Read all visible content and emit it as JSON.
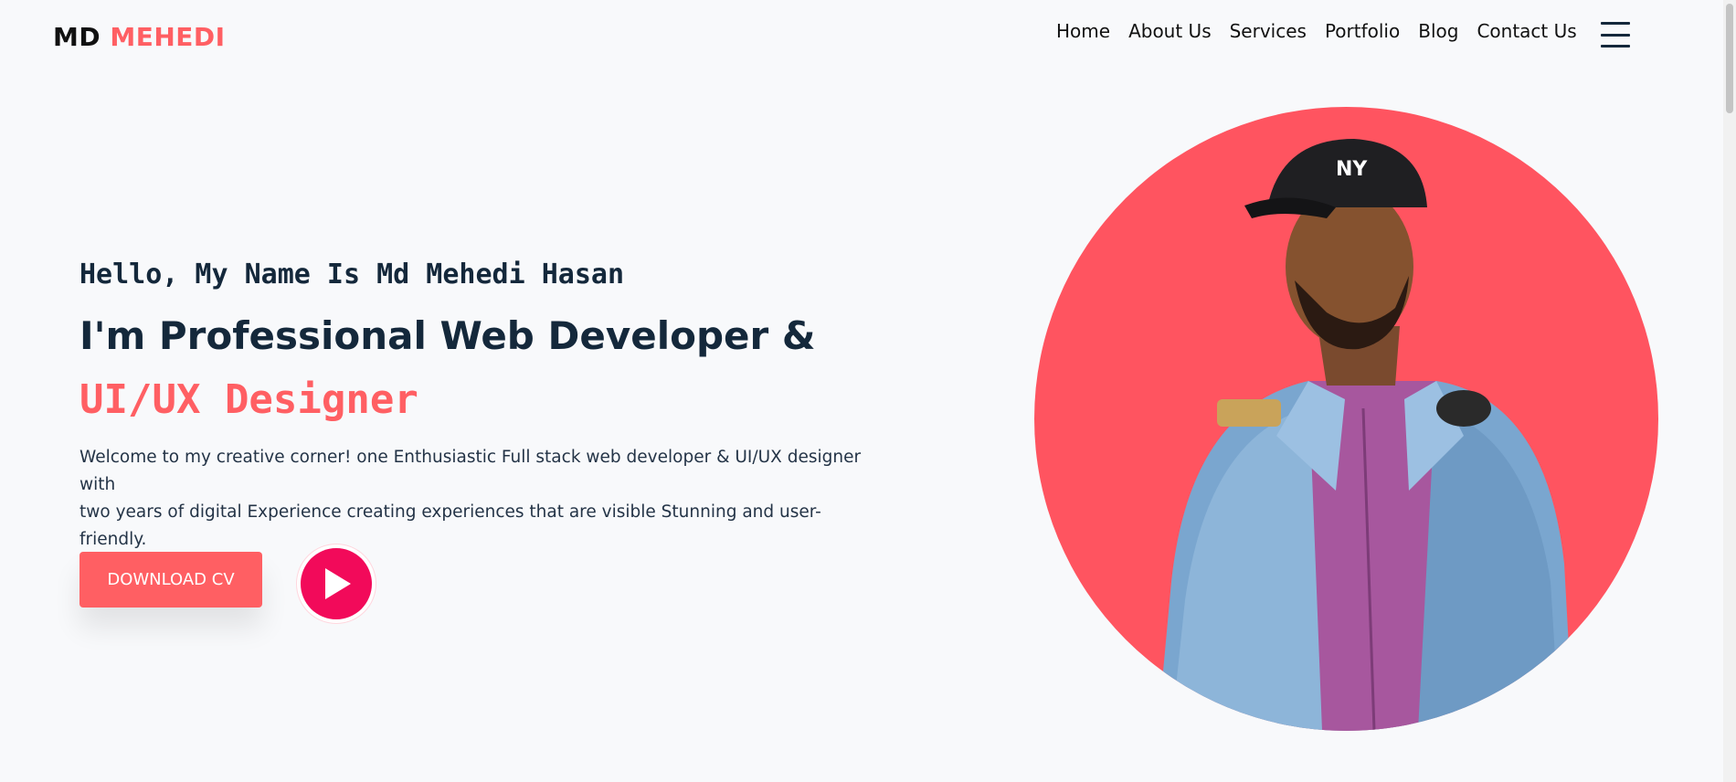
{
  "brand": {
    "first": "MD",
    "second": "MEHEDI",
    "accent_color": "#ff5f63"
  },
  "nav": {
    "items": [
      {
        "label": "Home"
      },
      {
        "label": "About Us"
      },
      {
        "label": "Services"
      },
      {
        "label": "Portfolio"
      },
      {
        "label": "Blog"
      },
      {
        "label": "Contact Us"
      }
    ],
    "menu_icon": "hamburger-menu-icon"
  },
  "hero": {
    "greeting": "Hello, My Name Is Md Mehedi Hasan",
    "headline": "I'm Professional Web Developer &",
    "role": "UI/UX Designer",
    "intro_line1": "Welcome to my creative corner! one Enthusiastic Full stack web developer & UI/UX designer with",
    "intro_line2": "two years of digital Experience creating experiences that are visible Stunning and user-friendly.",
    "cv_button": "DOWNLOAD CV",
    "play_icon": "play-icon",
    "play_color": "#f20a5a",
    "portrait_bg": "#ff5460"
  }
}
